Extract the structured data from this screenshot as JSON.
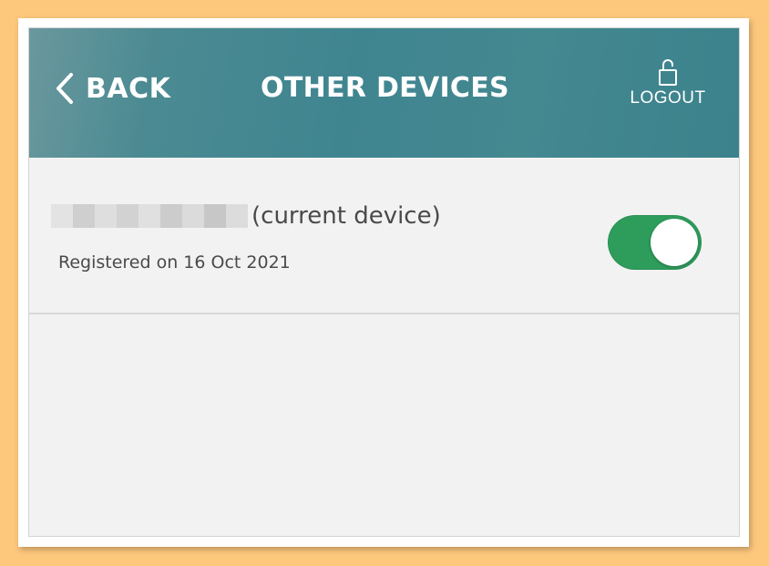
{
  "header": {
    "back_label": "BACK",
    "title": "OTHER DEVICES",
    "logout_label": "LOGOUT",
    "back_icon": "chevron-left-icon",
    "logout_icon": "unlocked-padlock-icon"
  },
  "device": {
    "name_suffix": "(current device)",
    "registered": "Registered on 16 Oct 2021",
    "enabled": true
  },
  "colors": {
    "header_bg": "#3f8590",
    "toggle_on": "#2e9d5c",
    "page_bg": "#f2f2f2",
    "outer_bg": "#fdc77c"
  }
}
